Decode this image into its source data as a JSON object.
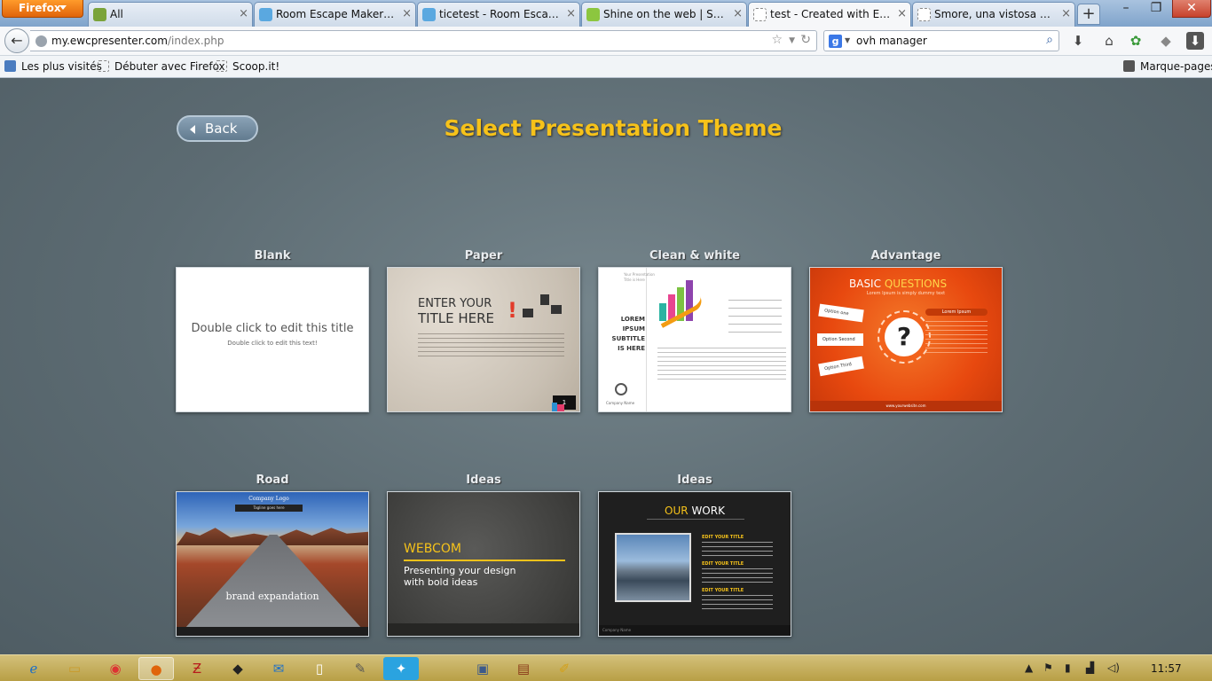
{
  "browser": {
    "menu_label": "Firefox",
    "tabs": [
      {
        "title": "All",
        "icon_color": "#7aa33a"
      },
      {
        "title": "Room Escape Maker - Cr...",
        "icon_color": "#5aa8e0"
      },
      {
        "title": "ticetest - Room Escape ...",
        "icon_color": "#5aa8e0"
      },
      {
        "title": "Shine on the web | Scoop...",
        "icon_color": "#8cc63f"
      },
      {
        "title": "test - Created with Easy ...",
        "icon_color": "#ffffff"
      },
      {
        "title": "Smore, una vistosa herra...",
        "icon_color": "#ffffff"
      }
    ],
    "new_tab_label": "+",
    "url_domain": "my.ewcpresenter.com",
    "url_path": "/index.php",
    "search_value": "ovh manager",
    "bookmarks": [
      "Les plus visités",
      "Débuter avec Firefox",
      "Scoop.it!"
    ],
    "bookmarks_menu_label": "Marque-pages"
  },
  "page": {
    "back_label": "Back",
    "heading": "Select Presentation Theme",
    "themes": [
      {
        "name": "Blank"
      },
      {
        "name": "Paper"
      },
      {
        "name": "Clean & white"
      },
      {
        "name": "Advantage"
      },
      {
        "name": "Road"
      },
      {
        "name": "Ideas"
      },
      {
        "name": "Ideas"
      }
    ],
    "thumb_text": {
      "blank_title": "Double click to edit this title",
      "blank_sub": "Double click to edit this text!",
      "paper_title1": "ENTER YOUR",
      "paper_title2": "TITLE HERE",
      "paper_badge": "1",
      "clean_side1": "Your Presentation",
      "clean_side2": "Title is Here",
      "clean_main": "LOREM IPSUM SUBTITLE IS HERE",
      "clean_company": "Company Name",
      "adv_title1": "BASIC",
      "adv_title2": "QUESTIONS",
      "adv_sub": "Lorem Ipsum is simply dummy text",
      "adv_q": "?",
      "adv_opt1": "Option one",
      "adv_opt2": "Option Second",
      "adv_opt3": "Option Third",
      "adv_pill": "Lorem Ipsum",
      "adv_footer": "www.yourwebsite.com",
      "road_logo": "Company Logo",
      "road_tag": "Tagline goes here",
      "road_brand": "brand expandation",
      "ideas1_title": "WEBCOM",
      "ideas1_sub1": "Presenting your design",
      "ideas1_sub2": "with bold ideas",
      "ideas2_title1": "OUR",
      "ideas2_title2": "WORK",
      "ideas2_item": "EDIT YOUR TITLE",
      "ideas2_footer": "Company Name"
    }
  },
  "taskbar": {
    "clock": "11:57"
  },
  "colors": {
    "heading": "#f6c21a",
    "firefox_orange": "#e0640a",
    "advantage_orange": "#f25a12"
  }
}
